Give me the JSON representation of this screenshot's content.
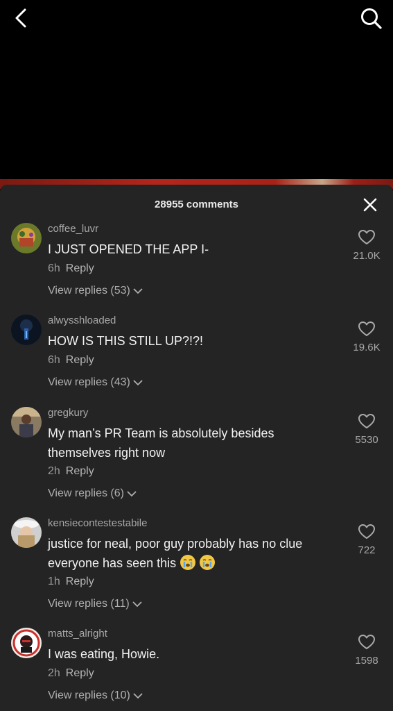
{
  "header": {
    "back_icon": "chevron-left-icon",
    "search_icon": "search-icon"
  },
  "sheet": {
    "comment_count_label": "28955 comments",
    "close_icon": "close-icon"
  },
  "comments": [
    {
      "username": "coffee_luvr",
      "text": "I JUST OPENED THE APP I-",
      "time": "6h",
      "reply_label": "Reply",
      "view_replies": "View replies (53)",
      "likes": "21.0K"
    },
    {
      "username": "alwysshloaded",
      "text": "HOW IS THIS STILL UP?!?!",
      "time": "6h",
      "reply_label": "Reply",
      "view_replies": "View replies (43)",
      "likes": "19.6K"
    },
    {
      "username": "gregkury",
      "text": "My man’s PR Team is absolutely besides themselves right now",
      "time": "2h",
      "reply_label": "Reply",
      "view_replies": "View replies (6)",
      "likes": "5530"
    },
    {
      "username": "kensiecontestestabile",
      "text": "justice for neal, poor guy probably has no clue everyone has seen this",
      "emojis": [
        "crying-face-emoji",
        "crying-face-emoji"
      ],
      "time": "1h",
      "reply_label": "Reply",
      "view_replies": "View replies (11)",
      "likes": "722"
    },
    {
      "username": "matts_alright",
      "text": "I was eating, Howie.",
      "time": "2h",
      "reply_label": "Reply",
      "view_replies": "View replies (10)",
      "likes": "1598"
    }
  ]
}
